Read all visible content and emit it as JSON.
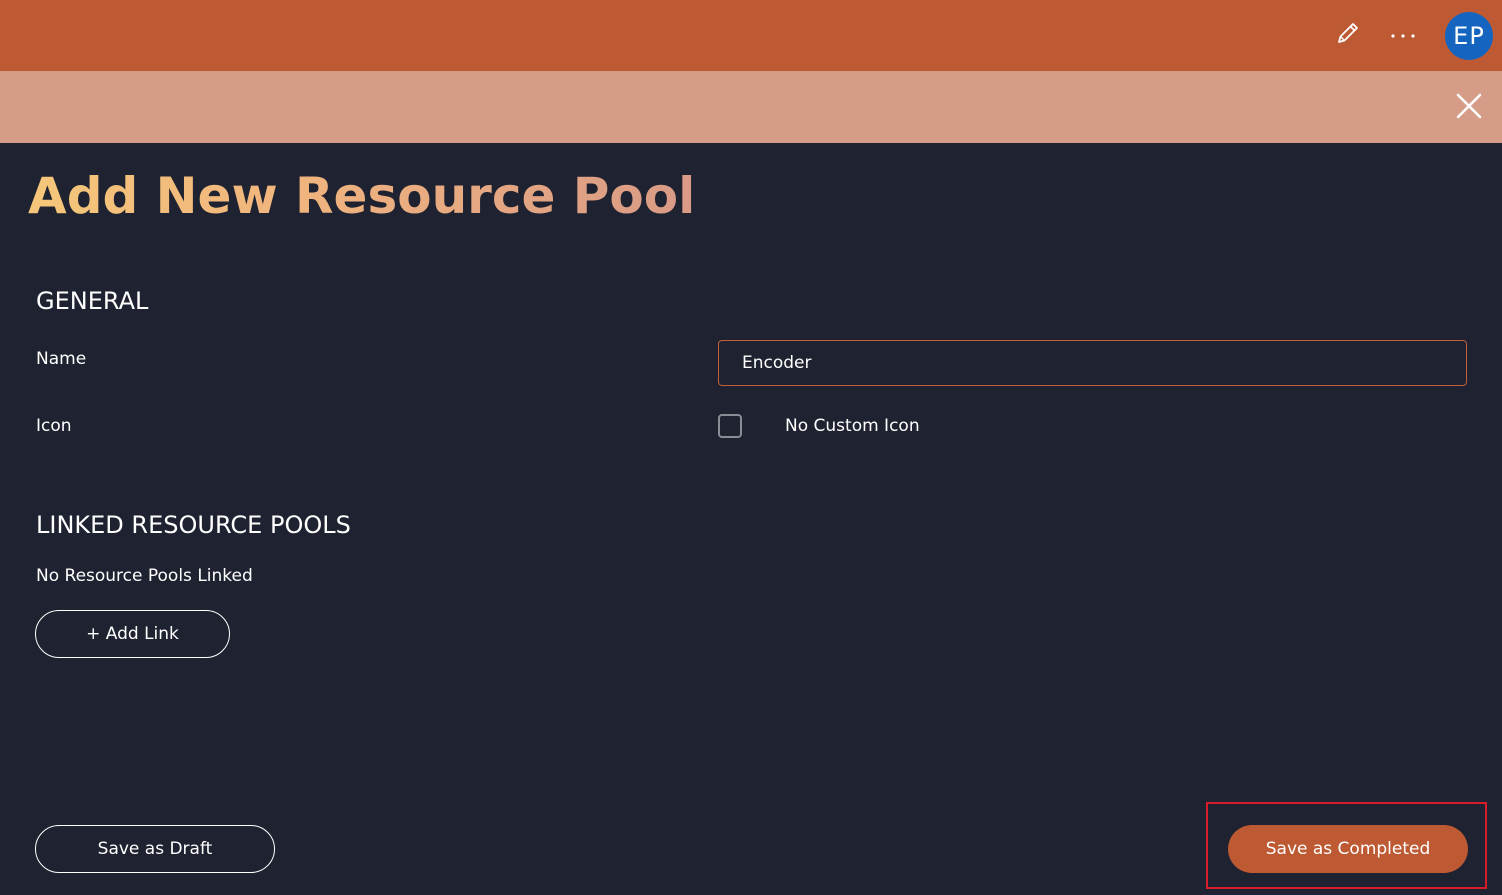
{
  "header": {
    "icons": [
      "pencil-icon",
      "more-horizontal-icon"
    ],
    "avatar_initials": "EP",
    "colors": {
      "bar": "#bd5a33",
      "subbar": "#d59c88",
      "avatar": "#1565c0"
    }
  },
  "subbar": {
    "close_icon": "close-icon"
  },
  "page": {
    "title": "Add New Resource Pool",
    "background": "#1f2230"
  },
  "general": {
    "heading": "GENERAL",
    "name_label": "Name",
    "name_value": "Encoder",
    "icon_label": "Icon",
    "no_custom_icon_label": "No Custom Icon",
    "no_custom_icon_checked": false
  },
  "linked": {
    "heading": "LINKED RESOURCE POOLS",
    "empty_text": "No Resource Pools Linked",
    "add_link_label": "+ Add Link"
  },
  "footer": {
    "save_draft_label": "Save as Draft",
    "save_completed_label": "Save as Completed",
    "accent": "#bd5a33",
    "highlight_color": "#d91c2a"
  }
}
